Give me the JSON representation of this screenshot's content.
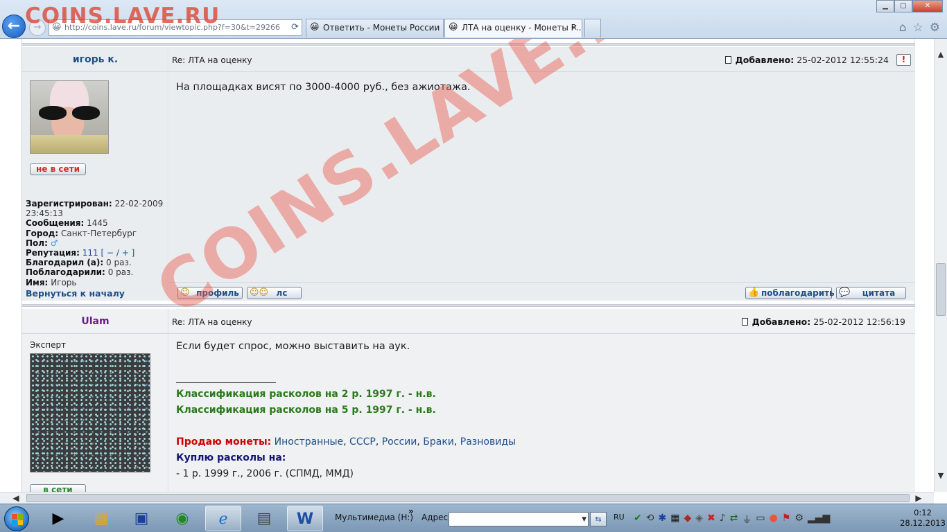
{
  "browser": {
    "address": "http://coins.lave.ru/forum/viewtopic.php?f=30&t=29266",
    "tabs": [
      {
        "title": "Ответить - Монеты России и ...",
        "active": false
      },
      {
        "title": "ЛТА на оценку - Монеты Р...",
        "active": true
      }
    ],
    "window_buttons": {
      "min": "▁",
      "max": "▢",
      "close": "✕"
    },
    "watermark_top": "COINS.LAVE.RU"
  },
  "watermark": "COINS.LAVE.RU",
  "posts": [
    {
      "author": "игорь к.",
      "author_color": "#1f4f88",
      "subject": "Re: ЛТА на оценку",
      "posted_label": "Добавлено:",
      "posted_date": "25-02-2012 12:55:24",
      "report_icon": "!",
      "status": "не в сети",
      "profile": {
        "registered_label": "Зарегистрирован:",
        "registered_value": "22-02-2009 23:45:13",
        "messages_label": "Сообщения:",
        "messages_value": "1445",
        "city_label": "Город:",
        "city_value": "Санкт-Петербург",
        "gender_label": "Пол:",
        "gender_icon": "♂",
        "rep_label": "Репутация:",
        "rep_value": "111",
        "rep_open": "[",
        "rep_minus": "−",
        "rep_slash": "/",
        "rep_plus": "+",
        "rep_close": "]",
        "thanked_label": "Благодарил (а):",
        "thanked_value": "0 раз.",
        "got_thanks_label": "Поблагодарили:",
        "got_thanks_value": "0 раз.",
        "name_label": "Имя:",
        "name_value": "Игорь"
      },
      "body": "На площадках висят по 3000-4000 руб., без ажиотажа.",
      "back_to_top": "Вернуться к началу",
      "buttons": {
        "profile": "профиль",
        "pm": "лс",
        "thank": "поблагодарить",
        "quote": "цитата"
      }
    },
    {
      "author": "Ulam",
      "author_color": "#6a1a86",
      "rank": "Эксперт",
      "subject": "Re: ЛТА на оценку",
      "posted_label": "Добавлено:",
      "posted_date": "25-02-2012 12:56:19",
      "status": "в сети",
      "body": "Если будет спрос, можно выставить на аук.",
      "signature": {
        "line1": "Классификация расколов на 2 р. 1997 г. - н.в.",
        "line2": "Классификация расколов на 5 р. 1997 г. - н.в.",
        "sell_label": "Продаю монеты:",
        "sell_links": [
          "Иностранные",
          "СССР",
          "России",
          "Браки",
          "Разновиды"
        ],
        "buy_label": "Куплю расколы на:",
        "buy_line": "- 1 р. 1999 г., 2006 г. (СПМД, ММД)"
      }
    }
  ],
  "taskbar": {
    "toolbar_label": "Мультимедиа (H:)",
    "toolbar_chevron": "»",
    "address_label": "Адрес",
    "address_value": "",
    "lang": "RU",
    "time": "0:12",
    "date": "28.12.2013"
  }
}
